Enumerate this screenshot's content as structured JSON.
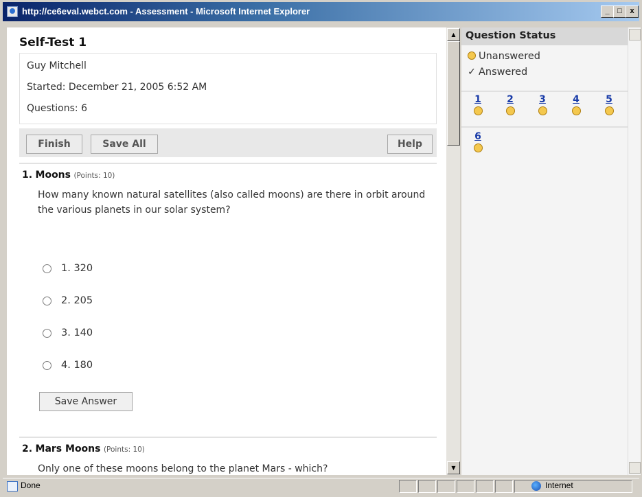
{
  "window": {
    "title": "http://ce6eval.webct.com - Assessment - Microsoft Internet Explorer",
    "controls": {
      "minimize": "_",
      "maximize": "□",
      "close": "x"
    }
  },
  "test": {
    "title": "Self-Test 1",
    "student": "Guy Mitchell",
    "started": "Started: December 21, 2005 6:52 AM",
    "questions_count": "Questions: 6"
  },
  "toolbar": {
    "finish_label": "Finish",
    "save_all_label": "Save All",
    "help_label": "Help"
  },
  "questions": [
    {
      "number": "1.",
      "title": "Moons",
      "points": "(Points: 10)",
      "text": "How many known natural satellites (also called moons) are there in orbit around the various planets in our solar system?",
      "choices": [
        "1. 320",
        "2. 205",
        "3. 140",
        "4. 180"
      ],
      "save_label": "Save Answer"
    },
    {
      "number": "2.",
      "title": "Mars Moons",
      "points": "(Points: 10)",
      "text": "Only one of these moons belong to the planet Mars - which?"
    }
  ],
  "status_panel": {
    "title": "Question Status",
    "legend": [
      {
        "icon": "unanswered-circle-icon",
        "label": "Unanswered"
      },
      {
        "icon": "checkmark-icon",
        "label": "Answered"
      }
    ],
    "question_links": [
      "1",
      "2",
      "3",
      "4",
      "5",
      "6"
    ],
    "status_color": "#f4c84e"
  },
  "statusbar": {
    "status_text": "Done",
    "zone_text": "Internet"
  }
}
